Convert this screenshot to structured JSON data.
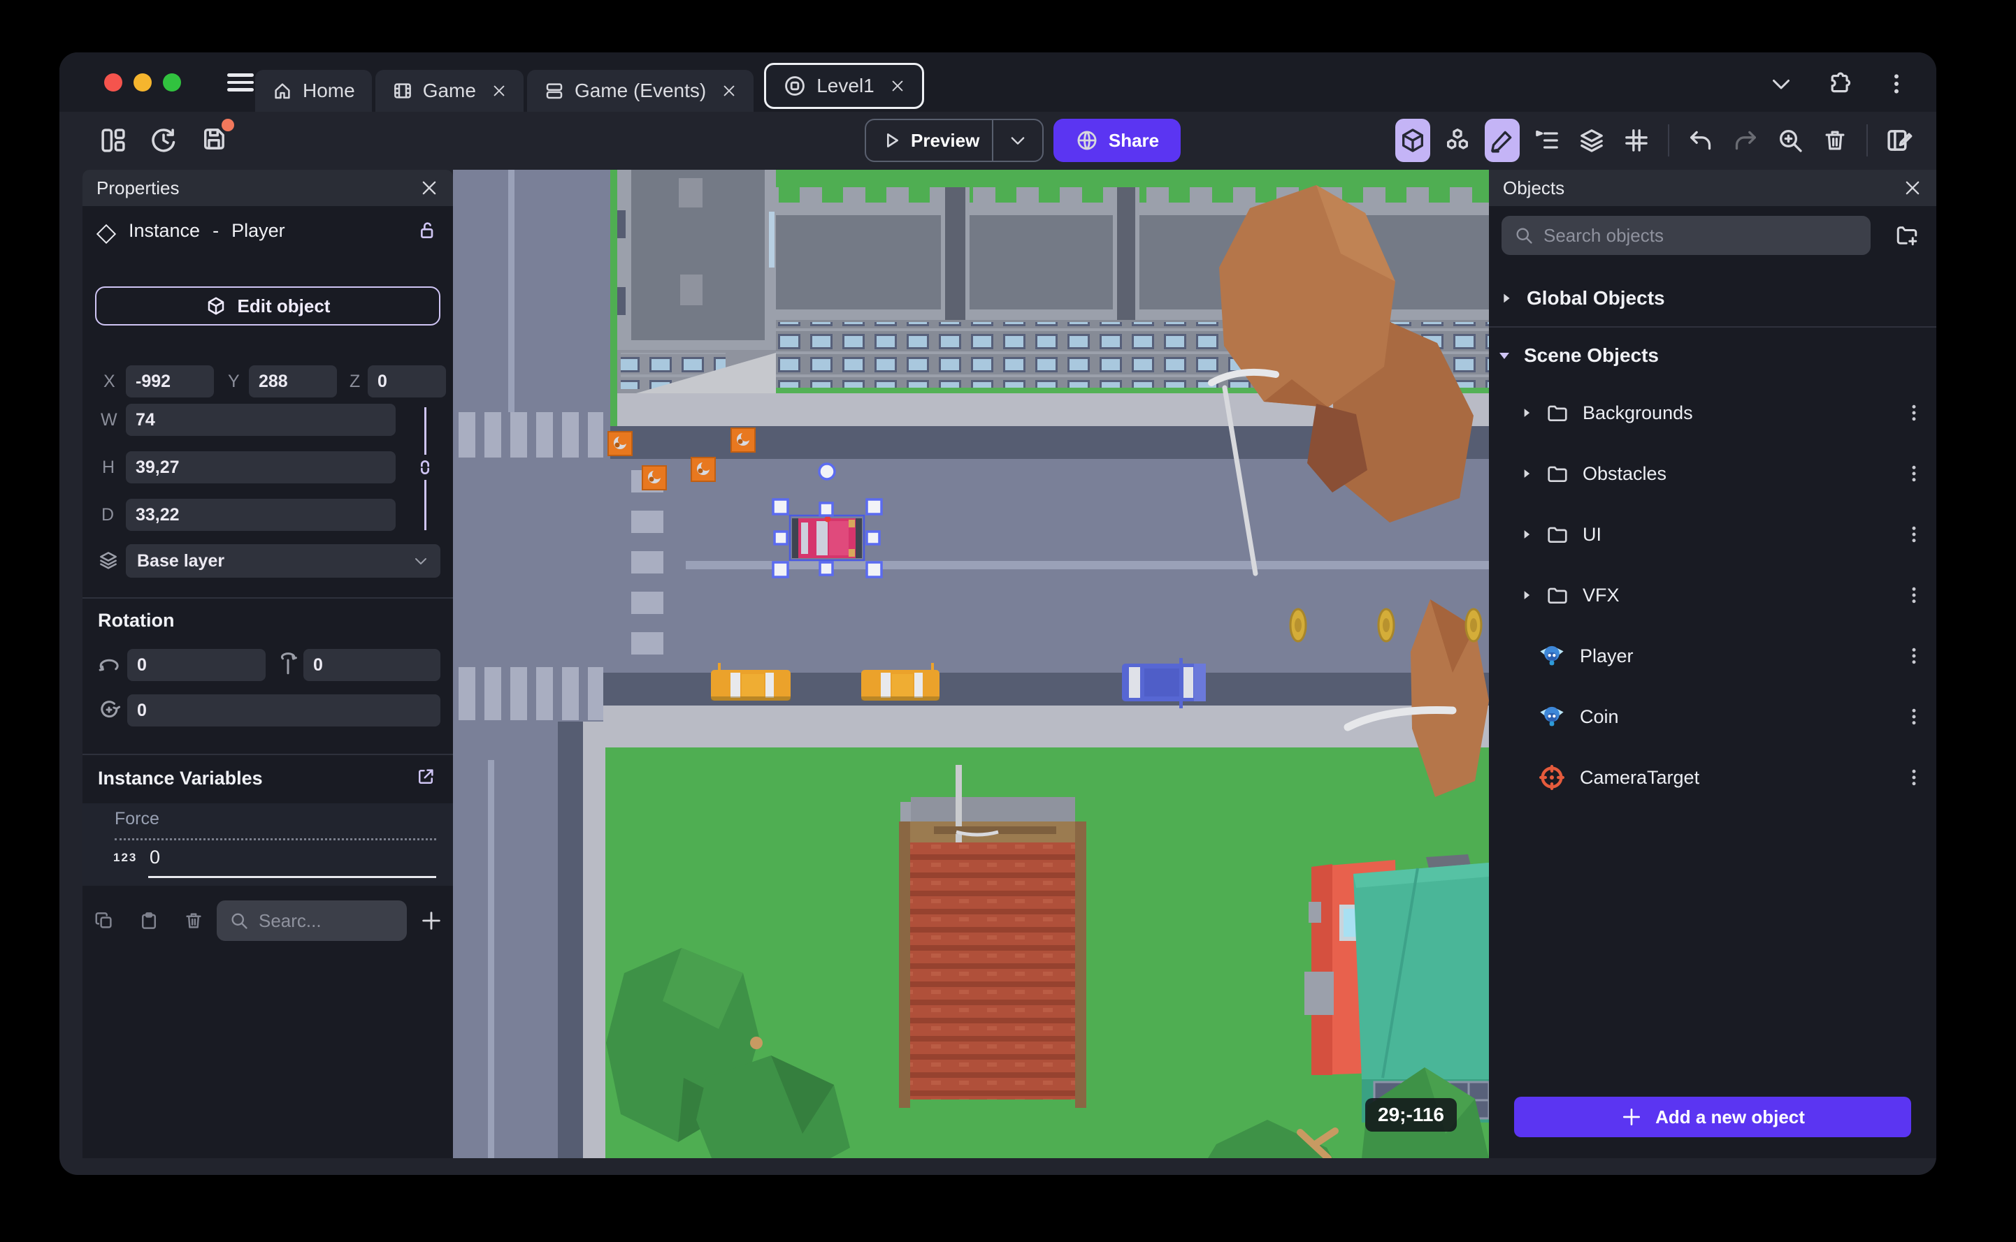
{
  "window": {
    "tabs": [
      {
        "label": "Home"
      },
      {
        "label": "Game"
      },
      {
        "label": "Game (Events)"
      },
      {
        "label": "Level1"
      }
    ]
  },
  "toolbar": {
    "preview_label": "Preview",
    "share_label": "Share"
  },
  "properties": {
    "title": "Properties",
    "instance_label": "Instance",
    "separator": "-",
    "instance_name": "Player",
    "edit_object_label": "Edit object",
    "x_label": "X",
    "x_value": "-992",
    "y_label": "Y",
    "y_value": "288",
    "z_label": "Z",
    "z_value": "0",
    "w_label": "W",
    "w_value": "74",
    "h_label": "H",
    "h_value": "39,27",
    "d_label": "D",
    "d_value": "33,22",
    "layer_value": "Base layer",
    "rotation_title": "Rotation",
    "rotation_x": "0",
    "rotation_y": "0",
    "rotation_z": "0",
    "variables_title": "Instance Variables",
    "variable": {
      "name": "Force",
      "type_badge": "123",
      "value": "0"
    },
    "variables_search_placeholder": "Searc..."
  },
  "objects": {
    "title": "Objects",
    "search_placeholder": "Search objects",
    "global_section": "Global Objects",
    "scene_section": "Scene Objects",
    "tree": [
      {
        "label": "Backgrounds"
      },
      {
        "label": "Obstacles"
      },
      {
        "label": "UI"
      },
      {
        "label": "VFX"
      },
      {
        "label": "Player"
      },
      {
        "label": "Coin"
      },
      {
        "label": "CameraTarget"
      }
    ],
    "add_button_label": "Add a new object"
  },
  "canvas": {
    "cursor_coordinates": "29;-116"
  },
  "colors": {
    "accent_purple": "#5b35f2",
    "toolbar_toggle_active": "#c4b4f6",
    "selection_blue": "#5b6bf0",
    "unsaved_dot": "#f2785c",
    "traffic_red": "#f5544d",
    "traffic_yellow": "#f5b52e",
    "traffic_green": "#31c23f"
  }
}
